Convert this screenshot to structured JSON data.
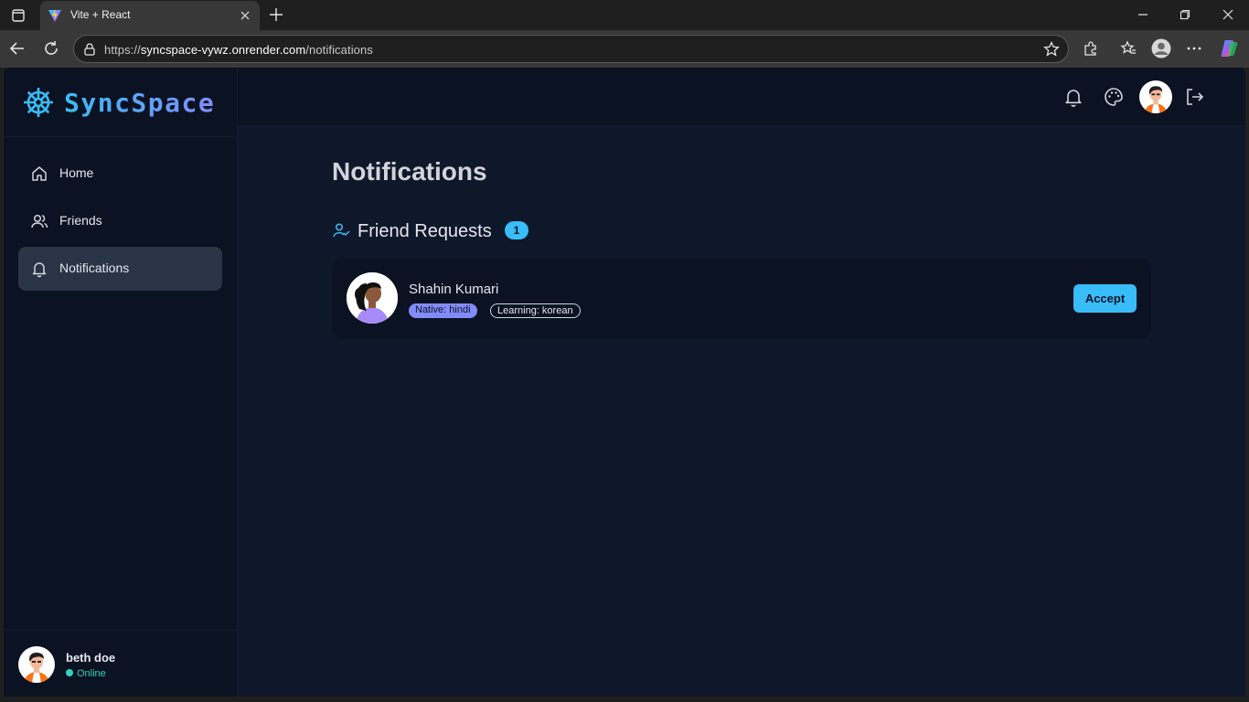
{
  "browser": {
    "tab_title": "Vite + React",
    "url_prefix": "https://",
    "url_host": "syncspace-vywz.onrender.com",
    "url_path": "/notifications"
  },
  "app": {
    "brand_name": "SyncSpace",
    "sidebar": {
      "items": [
        {
          "label": "Home",
          "icon": "home-icon"
        },
        {
          "label": "Friends",
          "icon": "users-icon"
        },
        {
          "label": "Notifications",
          "icon": "bell-icon",
          "active": true
        }
      ]
    },
    "user": {
      "name": "beth doe",
      "status": "Online"
    },
    "page_title": "Notifications",
    "friend_requests": {
      "title": "Friend Requests",
      "count": "1",
      "items": [
        {
          "name": "Shahin Kumari",
          "native": "Native: hindi",
          "learning": "Learning: korean",
          "action": "Accept"
        }
      ]
    }
  },
  "colors": {
    "accent": "#38bdf8",
    "secondary": "#818cf8",
    "online": "#2dd4bf",
    "background": "#0f172a"
  }
}
